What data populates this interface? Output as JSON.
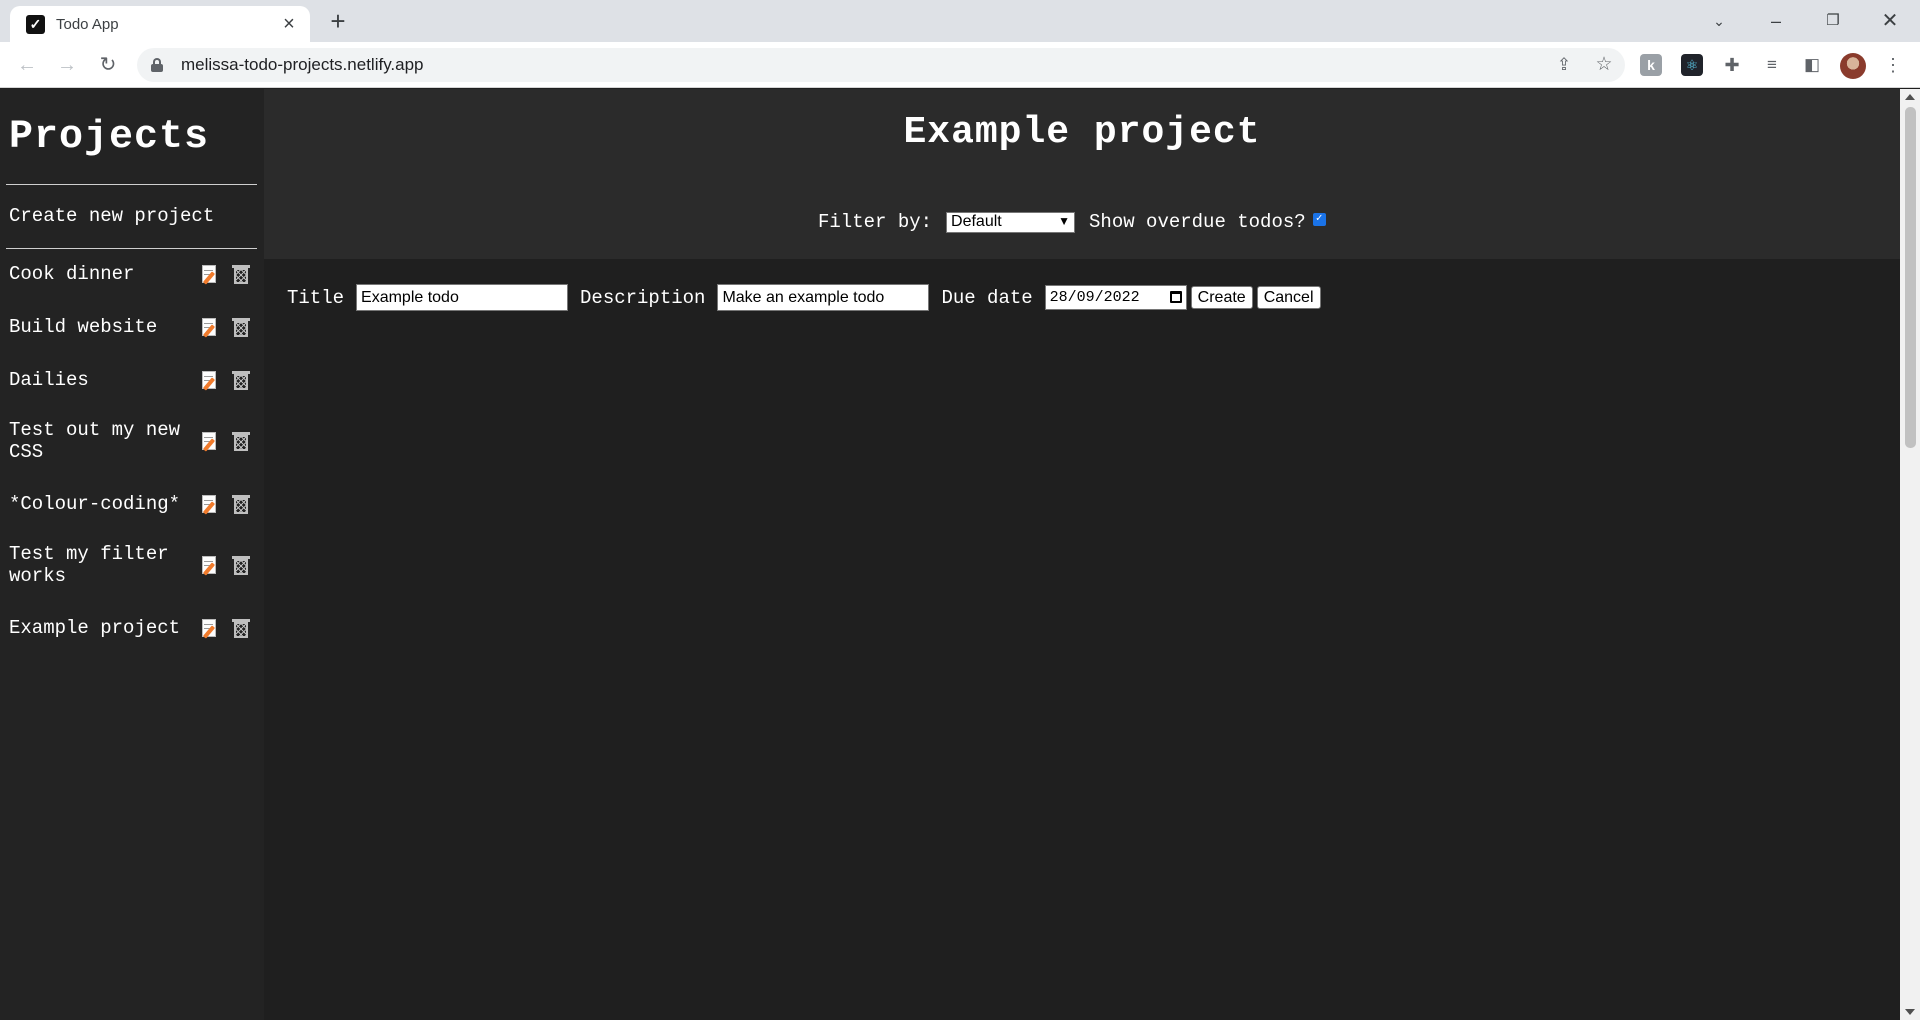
{
  "browser": {
    "tab_title": "Todo App",
    "url": "melissa-todo-projects.netlify.app"
  },
  "sidebar": {
    "title": "Projects",
    "create_label": "Create new project",
    "projects": [
      {
        "name": "Cook dinner"
      },
      {
        "name": "Build website"
      },
      {
        "name": "Dailies"
      },
      {
        "name": "Test out my new CSS"
      },
      {
        "name": "*Colour-coding*"
      },
      {
        "name": "Test my filter works"
      },
      {
        "name": "Example project"
      }
    ]
  },
  "main": {
    "title": "Example project",
    "filter_label": "Filter by:",
    "filter_value": "Default",
    "overdue_label": "Show overdue todos?",
    "overdue_checked": true
  },
  "form": {
    "title_label": "Title",
    "title_value": "Example todo",
    "description_label": "Description",
    "description_value": "Make an example todo",
    "due_label": "Due date",
    "due_value": "28/09/2022",
    "create_label": "Create",
    "cancel_label": "Cancel"
  }
}
